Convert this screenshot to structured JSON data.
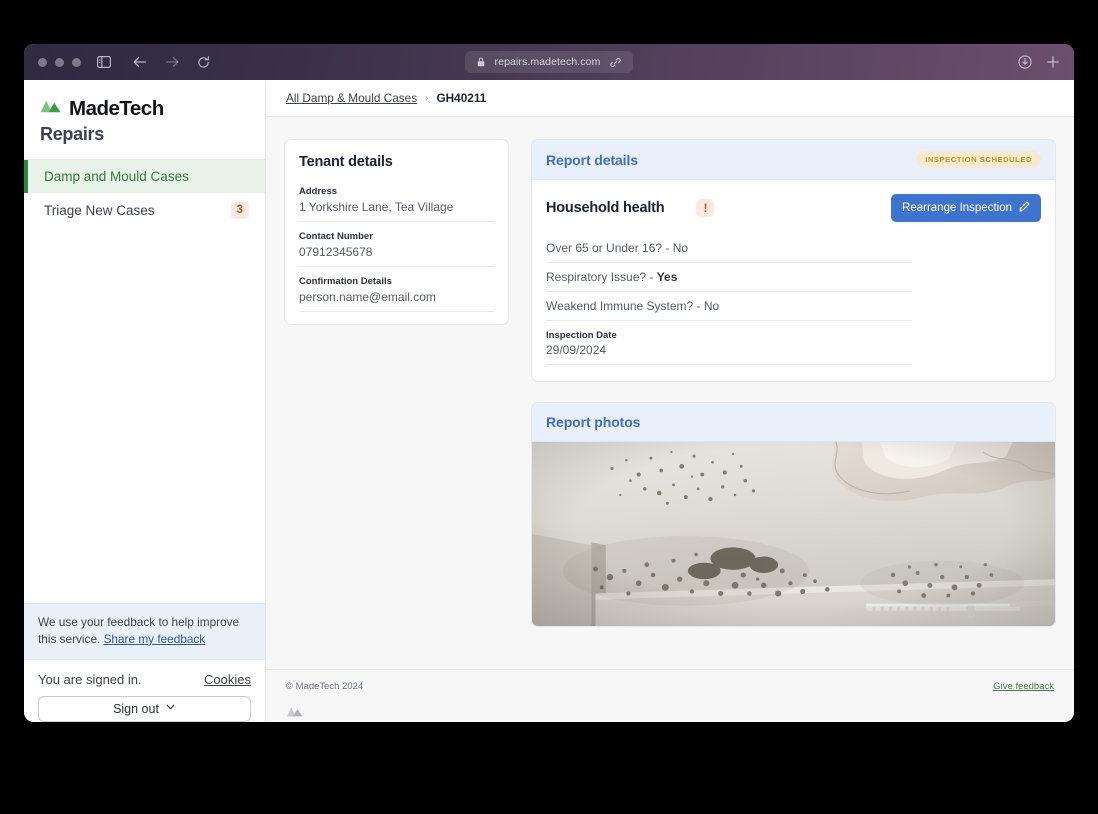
{
  "browser": {
    "url": "repairs.madetech.com",
    "lock_icon": "lock-icon",
    "link_icon": "link-icon",
    "back_icon": "back-arrow-icon",
    "forward_icon": "forward-arrow-icon",
    "reload_icon": "reload-icon",
    "sidebar_icon": "sidebar-toggle-icon",
    "download_icon": "download-icon",
    "new_tab_icon": "plus-icon"
  },
  "sidebar": {
    "brand_name": "MadeTech",
    "brand_sub": "Repairs",
    "logo_icon": "madetech-mountains-logo",
    "items": [
      {
        "label": "Damp and Mould Cases",
        "badge": "",
        "active": true
      },
      {
        "label": "Triage New Cases",
        "badge": "3",
        "active": false
      }
    ],
    "feedback": {
      "text": "We use your feedback to help improve this service.",
      "link": "Share my feedback"
    },
    "signed_in_text": "You are signed in.",
    "cookies_link": "Cookies",
    "signout_label": "Sign out"
  },
  "breadcrumb": {
    "parent": "All Damp  & Mould Cases",
    "separator": "›",
    "current": "GH40211"
  },
  "tenant": {
    "title": "Tenant details",
    "fields": [
      {
        "label": "Address",
        "value": "1 Yorkshire Lane, Tea Village"
      },
      {
        "label": "Contact Number",
        "value": "07912345678"
      },
      {
        "label": "Confirmation Details",
        "value": "person.name@email.com"
      }
    ]
  },
  "report": {
    "header_title": "Report details",
    "status": "INSPECTION SCHEDULED",
    "health_title": "Household health",
    "alert_icon": "alert-exclamation-icon",
    "rearrange_label": "Rearrange Inspection",
    "edit_icon": "pencil-icon",
    "rows": [
      {
        "question": "Over 65 or  Under 16? - ",
        "answer": "No",
        "bold": false
      },
      {
        "question": "Respiratory Issue?  - ",
        "answer": "Yes",
        "bold": true
      },
      {
        "question": "Weakend Immune System? - ",
        "answer": "No",
        "bold": false
      }
    ],
    "inspection_date_label": "Inspection Date",
    "inspection_date_value": "29/09/2024"
  },
  "photos": {
    "header_title": "Report photos",
    "alt": "Ceiling with black mould spots and peeling plaster above a curtain rail"
  },
  "footer": {
    "copyright": "© MadeTech 2024",
    "give_feedback": "Give feedback"
  },
  "colors": {
    "brand_green": "#2e8540",
    "accent_blue": "#3f74ce",
    "header_blue": "#eaf0fb",
    "status_amber": "#c9941f",
    "alert_orange": "#d4502a"
  }
}
